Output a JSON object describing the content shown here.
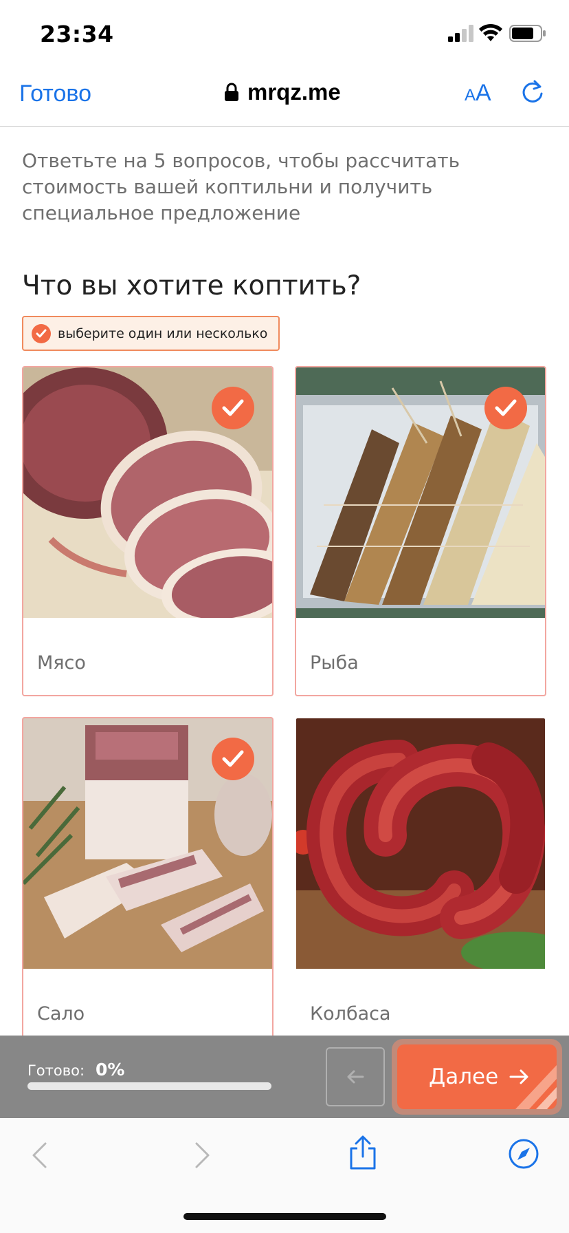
{
  "status_bar": {
    "time": "23:34"
  },
  "browser": {
    "done_label": "Готово",
    "url": "mrqz.me",
    "text_size_small": "A",
    "text_size_big": "A"
  },
  "quiz": {
    "intro": "Ответьте на 5 вопросов, чтобы рассчитать стоимость вашей коптильни и получить специальное предложение",
    "question": "Что вы хотите коптить?",
    "hint": "выберите один или несколько",
    "options": [
      {
        "label": "Мясо",
        "selected": true
      },
      {
        "label": "Рыба",
        "selected": true
      },
      {
        "label": "Сало",
        "selected": true
      },
      {
        "label": "Колбаса",
        "selected": false
      }
    ]
  },
  "progress": {
    "label": "Готово:",
    "value_text": "0%",
    "fraction": 0
  },
  "navigation": {
    "next_label": "Далее"
  },
  "colors": {
    "accent": "#f26a45",
    "link": "#1a73e8",
    "panel": "#878787"
  },
  "icons": [
    "lock-icon",
    "reload-icon",
    "check-icon",
    "arrow-left-icon",
    "arrow-right-icon",
    "chevron-left-icon",
    "chevron-right-icon",
    "share-icon",
    "compass-icon"
  ]
}
